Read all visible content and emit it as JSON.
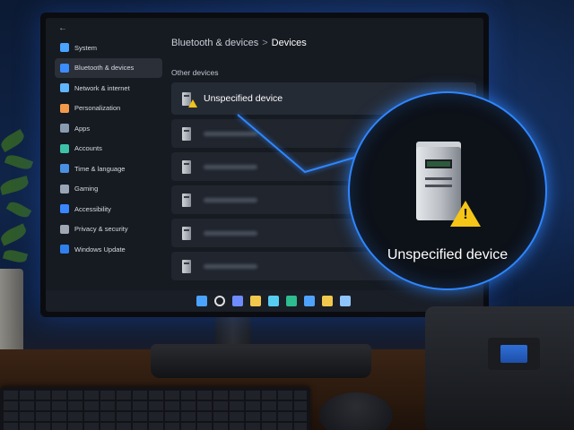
{
  "settings": {
    "sidebar": {
      "back": "←",
      "items": [
        {
          "label": "System",
          "color": "#4aa3ff"
        },
        {
          "label": "Bluetooth & devices",
          "color": "#3b8cff",
          "active": true
        },
        {
          "label": "Network & internet",
          "color": "#5fb6ff"
        },
        {
          "label": "Personalization",
          "color": "#f2994a"
        },
        {
          "label": "Apps",
          "color": "#8a9bb0"
        },
        {
          "label": "Accounts",
          "color": "#3dc1a8"
        },
        {
          "label": "Time & language",
          "color": "#4a90e2"
        },
        {
          "label": "Gaming",
          "color": "#9aa5b5"
        },
        {
          "label": "Accessibility",
          "color": "#3a86ff"
        },
        {
          "label": "Privacy & security",
          "color": "#a0a8b4"
        },
        {
          "label": "Windows Update",
          "color": "#2f80ed"
        }
      ]
    },
    "breadcrumb": {
      "parent": "Bluetooth & devices",
      "separator": ">",
      "current": "Devices"
    },
    "section": "Other devices",
    "devices": [
      {
        "label": "Unspecified device",
        "warning": true
      },
      {
        "label": "",
        "blurred": true
      },
      {
        "label": "",
        "blurred": true
      },
      {
        "label": "",
        "blurred": true
      },
      {
        "label": "",
        "blurred": true
      },
      {
        "label": "",
        "blurred": true
      }
    ]
  },
  "taskbar": {
    "icons": [
      "windows-icon",
      "search-icon",
      "chat-icon",
      "files-icon",
      "store-icon",
      "edge-icon",
      "photos-icon",
      "folder-icon",
      "media-icon"
    ],
    "colors": [
      "#4aa3ff",
      "#e0e0e0",
      "#6e8cff",
      "#f2c94c",
      "#56ccf2",
      "#2dbd8f",
      "#4fa3ff",
      "#f2c94c",
      "#8ec5ff"
    ]
  },
  "callout": {
    "label": "Unspecified device",
    "accent": "#2f86ff",
    "warning_color": "#f5c518"
  }
}
